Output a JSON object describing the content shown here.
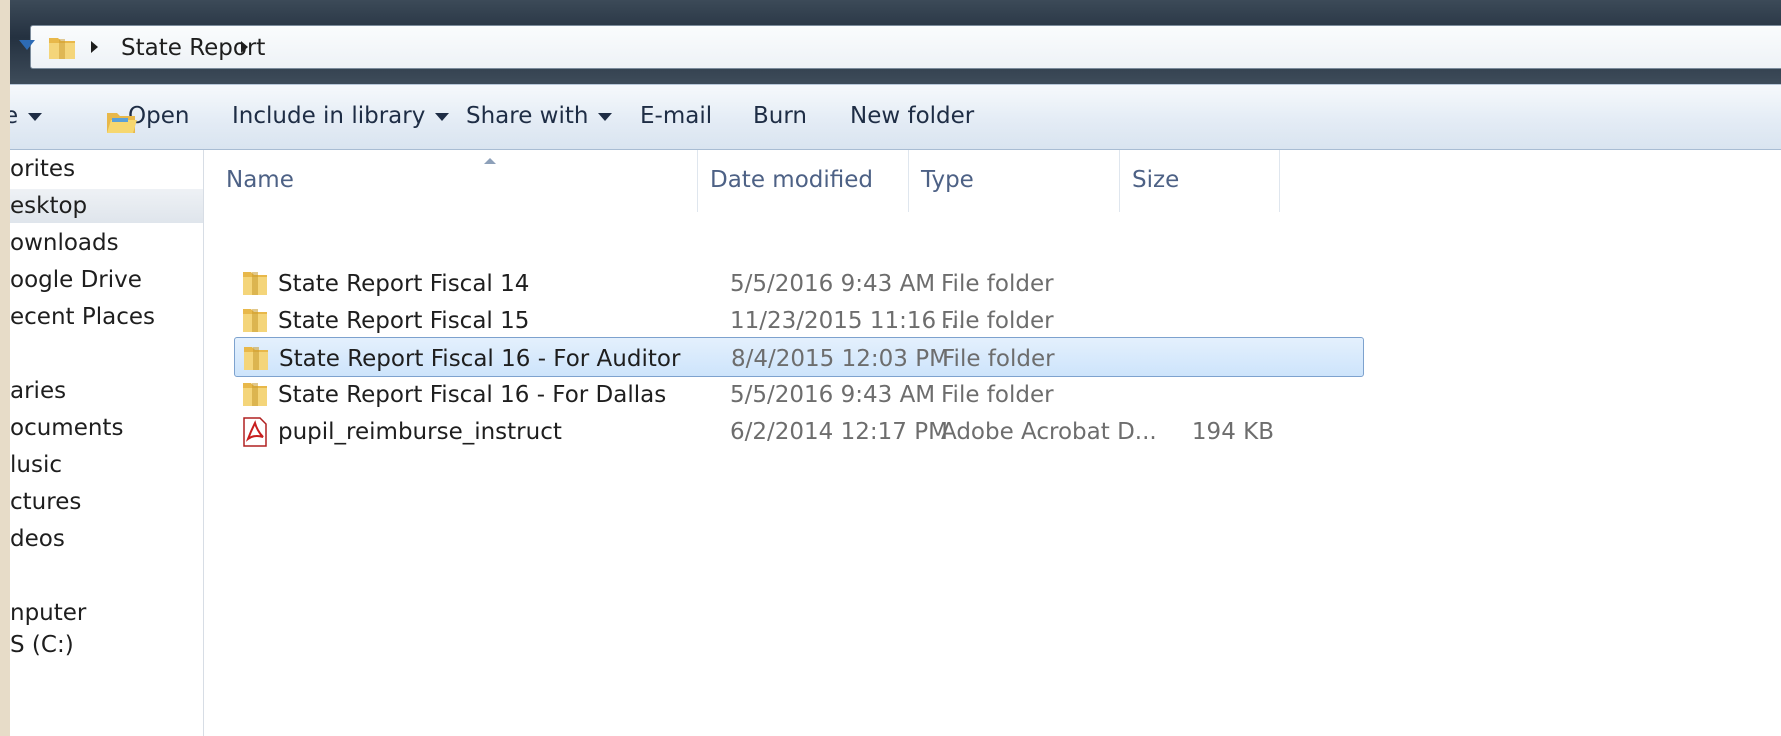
{
  "address_bar": {
    "breadcrumb": [
      "State Report"
    ]
  },
  "command_bar": {
    "organize_fragment": "e",
    "open_label": "Open",
    "include_library_label": "Include in library",
    "share_with_label": "Share with",
    "email_label": "E-mail",
    "burn_label": "Burn",
    "new_folder_label": "New folder"
  },
  "nav_pane": {
    "items": [
      {
        "label": "orites"
      },
      {
        "label": "esktop"
      },
      {
        "label": "ownloads"
      },
      {
        "label": "oogle Drive"
      },
      {
        "label": "ecent Places"
      },
      {
        "label": "aries"
      },
      {
        "label": "ocuments"
      },
      {
        "label": "lusic"
      },
      {
        "label": "ctures"
      },
      {
        "label": "deos"
      },
      {
        "label": "nputer"
      },
      {
        "label": "S (C:)"
      }
    ]
  },
  "file_list": {
    "columns": {
      "name": "Name",
      "date_modified": "Date modified",
      "type": "Type",
      "size": "Size"
    },
    "rows": [
      {
        "name": "State Report Fiscal 14",
        "date": "5/5/2016 9:43 AM",
        "type": "File folder",
        "size": "",
        "icon": "folder-icon"
      },
      {
        "name": "State Report Fiscal 15",
        "date": "11/23/2015 11:16 ...",
        "type": "File folder",
        "size": "",
        "icon": "folder-icon"
      },
      {
        "name": "State Report Fiscal 16 - For Auditor",
        "date": "8/4/2015 12:03 PM",
        "type": "File folder",
        "size": "",
        "icon": "folder-icon",
        "selected": true
      },
      {
        "name": "State Report Fiscal 16 - For Dallas",
        "date": "5/5/2016 9:43 AM",
        "type": "File folder",
        "size": "",
        "icon": "folder-icon"
      },
      {
        "name": "pupil_reimburse_instruct",
        "date": "6/2/2014 12:17 PM",
        "type": "Adobe Acrobat D...",
        "size": "194 KB",
        "icon": "pdf-icon"
      }
    ]
  },
  "colors": {
    "selection_fill": "#cde4fb",
    "selection_border": "#7da2ce",
    "header_text": "#4d6185",
    "folder": "#e8b84a"
  }
}
